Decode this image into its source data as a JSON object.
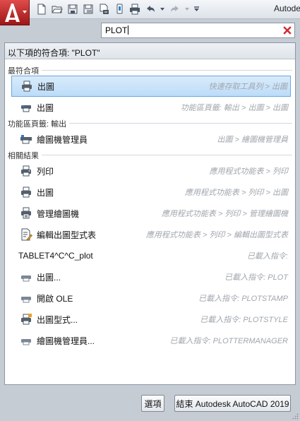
{
  "titlebar": {
    "title_fragment": "Autode",
    "quick_access_icons": [
      "new-icon",
      "open-icon",
      "save-icon",
      "save-as-icon",
      "open-from-web-icon",
      "save-to-web-icon",
      "plot-icon",
      "undo-icon",
      "redo-icon",
      "customize-icon"
    ]
  },
  "search": {
    "query": "PLOT",
    "clear_icon": "clear-icon"
  },
  "results": {
    "header": "以下項的符合項: \"PLOT\"",
    "groups": [
      {
        "title": "最符合項",
        "items": [
          {
            "label": "出圖",
            "path": "快速存取工具列 > 出圖",
            "icon": "plot-icon",
            "selected": true
          },
          {
            "label": "出圖",
            "path": "功能區頁籤: 輸出 > 出圖 > 出圖",
            "icon": "plot-ribbon-icon",
            "selected": false
          }
        ]
      },
      {
        "title": "功能區頁籤: 輸出",
        "items": [
          {
            "label": "繪圖機管理員",
            "path": "出圖 > 繪圖機管理員",
            "icon": "plotter-manager-icon",
            "selected": false
          }
        ]
      },
      {
        "title": "相關結果",
        "items": [
          {
            "label": "列印",
            "path": "應用程式功能表 > 列印",
            "icon": "print-icon",
            "selected": false
          },
          {
            "label": "出圖",
            "path": "應用程式功能表 > 列印 > 出圖",
            "icon": "plot-icon",
            "selected": false
          },
          {
            "label": "管理繪圖機",
            "path": "應用程式功能表 > 列印 > 管理繪圖機",
            "icon": "manage-plotters-icon",
            "selected": false
          },
          {
            "label": "編輯出圖型式表",
            "path": "應用程式功能表 > 列印 > 編輯出圖型式表",
            "icon": "edit-plot-style-icon",
            "selected": false
          },
          {
            "label": "TABLET4^C^C_plot",
            "path": "已載入指令:",
            "icon": "",
            "selected": false
          },
          {
            "label": "出圖...",
            "path": "已載入指令: PLOT",
            "icon": "command-icon",
            "selected": false
          },
          {
            "label": "開啟 OLE",
            "path": "已載入指令: PLOTSTAMP",
            "icon": "command-icon",
            "selected": false
          },
          {
            "label": "出圖型式...",
            "path": "已載入指令: PLOTSTYLE",
            "icon": "plot-style-icon",
            "selected": false
          },
          {
            "label": "繪圖機管理員...",
            "path": "已載入指令: PLOTTERMANAGER",
            "icon": "command-icon",
            "selected": false
          }
        ]
      }
    ]
  },
  "footer": {
    "options_label": "選項",
    "exit_label": "結束 Autodesk AutoCAD 2019"
  },
  "colors": {
    "app_button": "#c42b2b",
    "selection": "#cfe6fb",
    "selection_border": "#69a7dd",
    "path_text": "#a0a6ad"
  }
}
